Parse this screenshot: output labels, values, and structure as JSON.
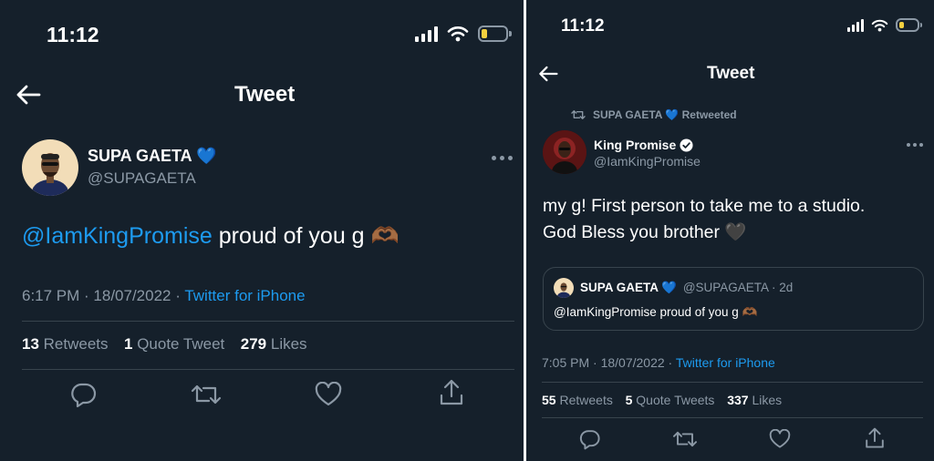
{
  "left": {
    "status_time": "11:12",
    "header_title": "Tweet",
    "author_name": "SUPA GAETA",
    "author_emoji": "💙",
    "author_handle": "@SUPAGAETA",
    "mention": "@IamKingPromise",
    "text": " proud of you g ",
    "text_emoji": "🫶🏾",
    "timestamp": "6:17 PM · 18/07/2022 · ",
    "source": "Twitter for iPhone",
    "retweets_count": "13",
    "retweets_label": "Retweets",
    "quotes_count": "1",
    "quotes_label": "Quote Tweet",
    "likes_count": "279",
    "likes_label": "Likes"
  },
  "right": {
    "status_time": "11:12",
    "header_title": "Tweet",
    "retweeted_by": "SUPA GAETA 💙 Retweeted",
    "author_name": "King Promise",
    "author_handle": "@IamKingPromise",
    "text_line1": "my g! First person to take me to a studio.",
    "text_line2": "God Bless you brother 🖤",
    "quote": {
      "author_name": "SUPA GAETA 💙",
      "author_handle": "@SUPAGAETA · 2d",
      "text": "@IamKingPromise proud of you g 🫶🏾"
    },
    "timestamp": "7:05 PM · 18/07/2022 · ",
    "source": "Twitter for iPhone",
    "retweets_count": "55",
    "retweets_label": "Retweets",
    "quotes_count": "5",
    "quotes_label": "Quote Tweets",
    "likes_count": "337",
    "likes_label": "Likes"
  },
  "icons": {
    "back": "arrow-left-icon",
    "more": "more-horizontal-icon",
    "verified": "verified-badge-icon",
    "reply": "reply-icon",
    "retweet": "retweet-icon",
    "like": "heart-icon",
    "share": "share-icon",
    "signal": "cellular-signal-icon",
    "wifi": "wifi-icon",
    "battery": "battery-icon"
  },
  "colors": {
    "background": "#15202b",
    "link": "#1d9bf0",
    "muted": "#8b98a5",
    "divider": "#38444d",
    "battery": "#f4d03f"
  }
}
